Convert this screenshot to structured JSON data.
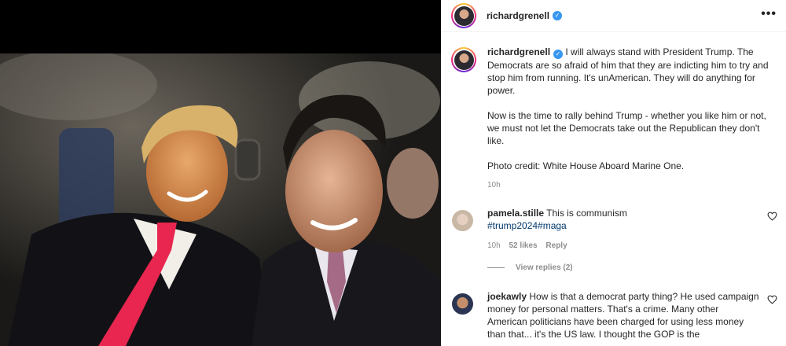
{
  "post": {
    "username": "richardgrenell",
    "more_icon": "•••",
    "verified_icon": "✓",
    "caption_paragraphs": "I will always stand with President Trump. The Democrats are so afraid of him that they are indicting him to try and stop him from running. It's unAmerican. They will do anything for power.\n\nNow is the time to rally behind Trump - whether you like him or not, we must not let the Democrats take out the Republican they don't like.\n\nPhoto credit: White House Aboard Marine One.",
    "time": "10h"
  },
  "comments": [
    {
      "username": "pamela.stille",
      "text": "This is communism",
      "hashtags": "#trump2024#maga",
      "time": "10h",
      "likes": "52 likes",
      "reply": "Reply",
      "view_replies": "View replies (2)"
    },
    {
      "username": "joekawly",
      "text": "How is that a democrat party thing? He used campaign money for personal matters. That's a crime. Many other American politicians have been charged for using less money than that... it's the US law. I thought the GOP is the"
    }
  ],
  "colors": {
    "link": "#00376b",
    "muted": "#8e8e8e",
    "verified": "#3897f0",
    "tie": "#e8264f"
  },
  "icons": [
    "verified-icon",
    "more-options-icon",
    "heart-icon"
  ]
}
